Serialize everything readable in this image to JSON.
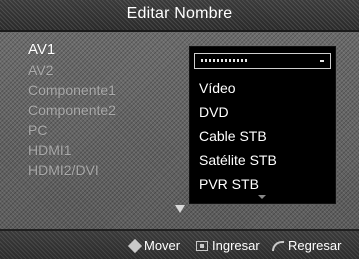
{
  "header": {
    "title": "Editar Nombre"
  },
  "left_list": {
    "items": [
      {
        "label": "AV1",
        "active": true
      },
      {
        "label": "AV2",
        "active": false
      },
      {
        "label": "Componente1",
        "active": false
      },
      {
        "label": "Componente2",
        "active": false
      },
      {
        "label": "PC",
        "active": false
      },
      {
        "label": "HDMI1",
        "active": false
      },
      {
        "label": "HDMI2/DVI",
        "active": false
      }
    ]
  },
  "dropdown": {
    "options": [
      "Vídeo",
      "DVD",
      "Cable STB",
      "Satélite STB",
      "PVR STB"
    ]
  },
  "footer": {
    "move_label": "Mover",
    "enter_label": "Ingresar",
    "return_label": "Regresar"
  }
}
